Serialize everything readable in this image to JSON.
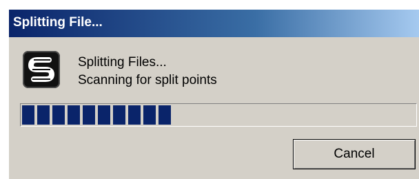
{
  "window": {
    "title": "Splitting File..."
  },
  "app_icon": {
    "icon": "stylized-s-logo"
  },
  "message": {
    "line1": "Splitting Files...",
    "line2": "Scanning for split points"
  },
  "progress": {
    "fraction": 0.38,
    "color": "#0a246a"
  },
  "buttons": {
    "cancel_label": "Cancel"
  },
  "colors": {
    "titlebar_start": "#0a246a",
    "titlebar_end": "#a6caf0",
    "dialog_background": "#d4d0c8"
  }
}
